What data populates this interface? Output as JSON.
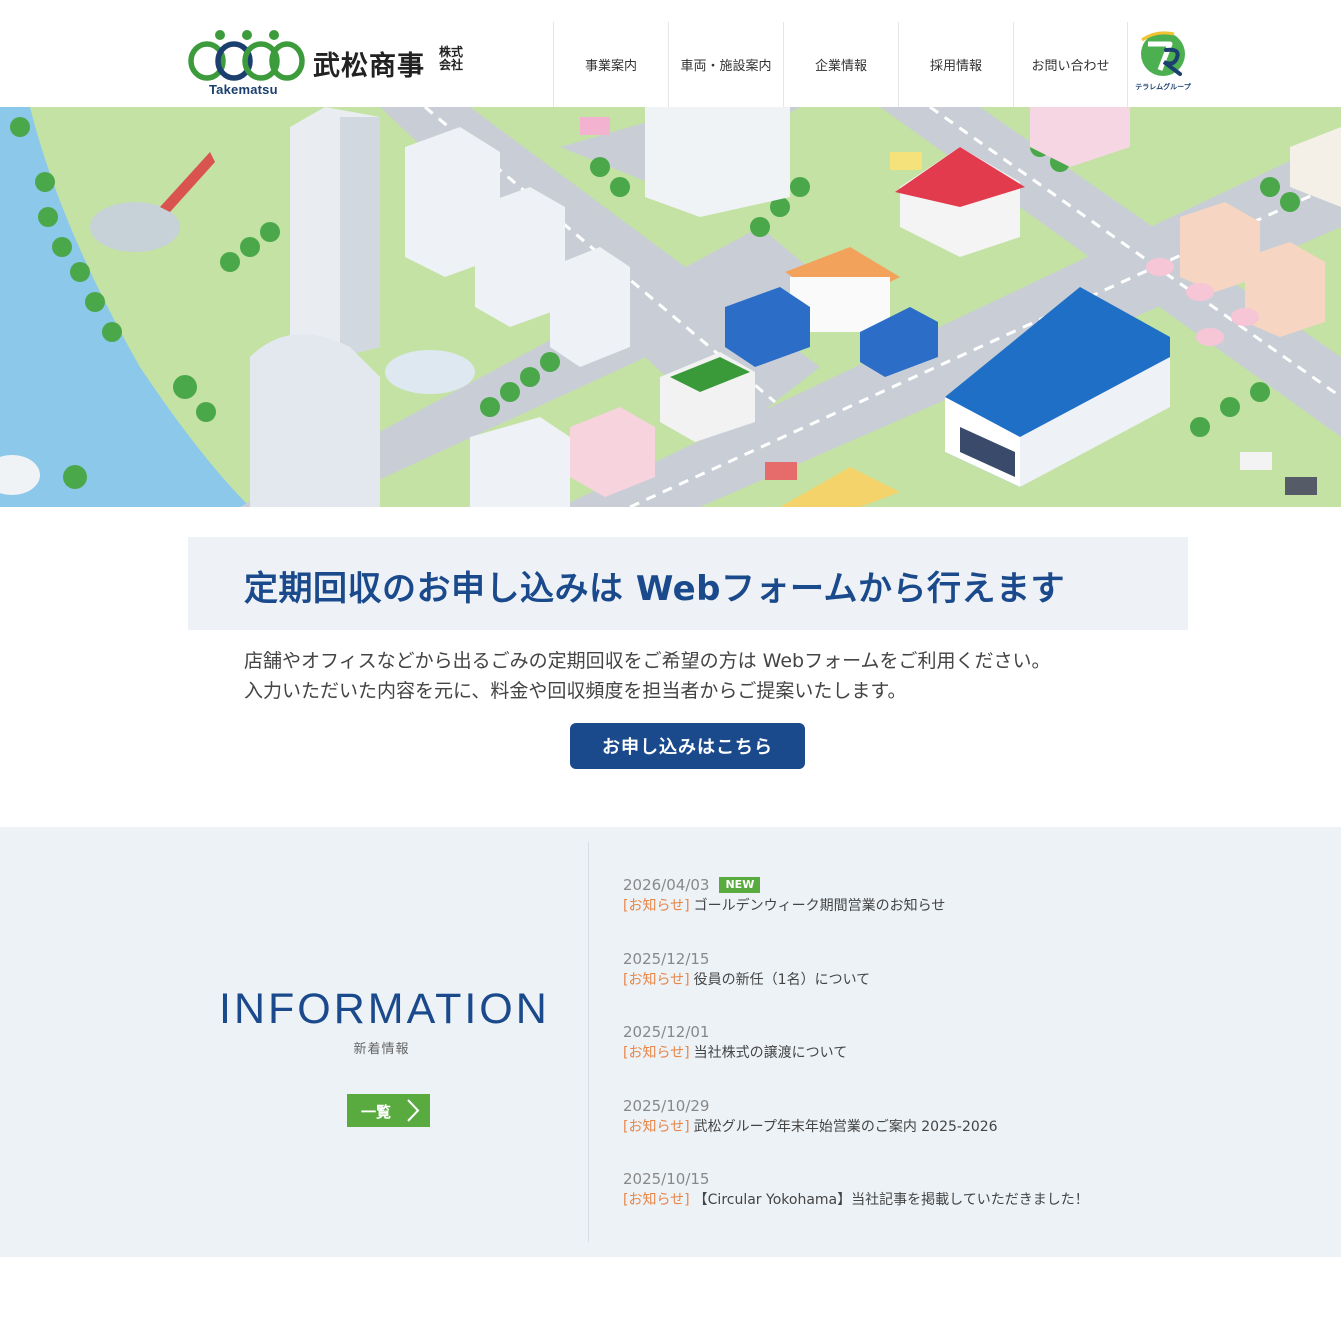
{
  "header": {
    "logo_en": "Takematsu",
    "logo_jp": "武松商事",
    "logo_jp_small": "株式会社",
    "group_logo_text": "テラレムグループ",
    "nav": [
      {
        "label": "事業案内"
      },
      {
        "label": "車両・施設案内"
      },
      {
        "label": "企業情報"
      },
      {
        "label": "採用情報"
      },
      {
        "label": "お問い合わせ"
      }
    ]
  },
  "form_section": {
    "title": "定期回収のお申し込みは Webフォームから行えます",
    "text_line1": "店舗やオフィスなどから出るごみの定期回収をご希望の方は Webフォームをご利用ください。",
    "text_line2": "入力いただいた内容を元に、料金や回収頻度を担当者からご提案いたします。",
    "button_label": "お申し込みはこちら"
  },
  "information": {
    "heading": "INFORMATION",
    "sub": "新着情報",
    "button_label": "一覧",
    "items": [
      {
        "date": "2026/04/03",
        "badge": "NEW",
        "category": "[お知らせ]",
        "title": "ゴールデンウィーク期間営業のお知らせ"
      },
      {
        "date": "2025/12/15",
        "category": "[お知らせ]",
        "title": "役員の新任（1名）について"
      },
      {
        "date": "2025/12/01",
        "category": "[お知らせ]",
        "title": "当社株式の譲渡について"
      },
      {
        "date": "2025/10/29",
        "category": "[お知らせ]",
        "title": "武松グループ年末年始営業のご案内 2025-2026"
      },
      {
        "date": "2025/10/15",
        "category": "[お知らせ]",
        "title": "【Circular Yokohama】当社記事を掲載していただきました！"
      }
    ]
  },
  "colors": {
    "brand_blue": "#1a4a8c",
    "brand_green": "#5aab3f",
    "category_orange": "#e8874a"
  }
}
